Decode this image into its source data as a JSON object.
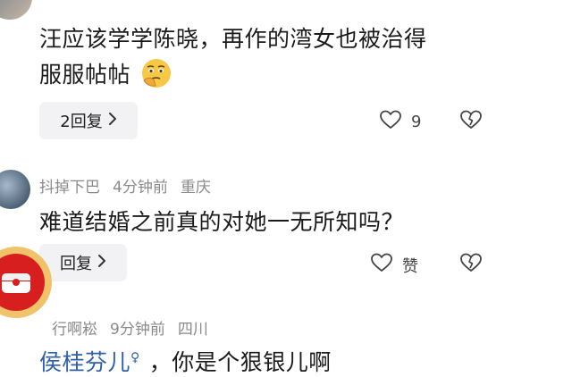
{
  "comments": [
    {
      "line1": "汪应该学学陈晓，再作的湾女也被治得",
      "line2": "服服帖帖",
      "reply_label": "2回复",
      "like_count": "9"
    },
    {
      "username": "抖掉下巴",
      "time": "4分钟前",
      "location": "重庆",
      "text": "难道结婚之前真的对她一无所知吗？",
      "reply_label": "回复",
      "like_label": "赞"
    },
    {
      "username": "行啊崧",
      "time": "9分钟前",
      "location": "四川",
      "mention": "侯桂芬儿",
      "mention_badge": "♀",
      "text": "，你是个狠银儿啊"
    }
  ],
  "icons": {
    "reply_chevron": "chevron-right-icon",
    "like": "heart-outline-icon",
    "dislike": "broken-heart-icon",
    "emoji": "thinking-face-emoji"
  },
  "colors": {
    "mention": "#2f5fa6",
    "meta": "#8a8a8a",
    "reply_bg": "#f2f2f4"
  }
}
